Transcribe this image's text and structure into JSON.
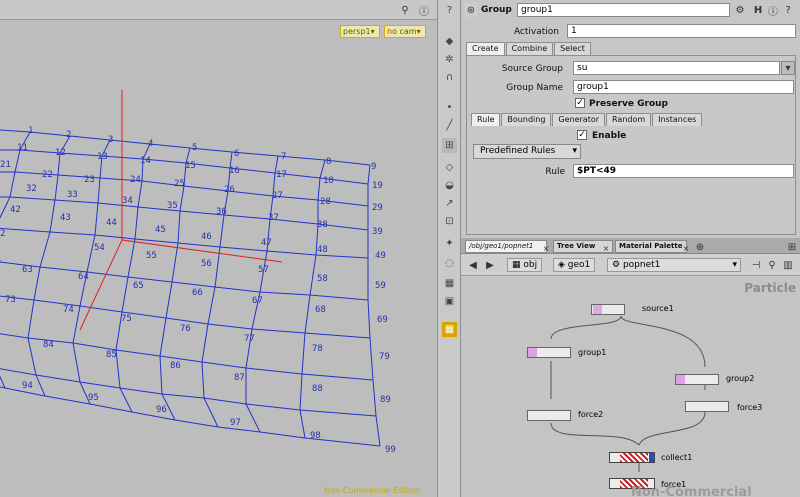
{
  "viewport": {
    "camera": "persp1▾",
    "cam": "no cam▾",
    "nc_text": "Non-Commercial Edition",
    "point_labels": [
      "1",
      "2",
      "3",
      "4",
      "5",
      "6",
      "7",
      "8",
      "9",
      "11",
      "12",
      "13",
      "14",
      "15",
      "16",
      "17",
      "18",
      "19",
      "21",
      "22",
      "23",
      "24",
      "25",
      "26",
      "27",
      "28",
      "29",
      "32",
      "33",
      "34",
      "35",
      "36",
      "37",
      "38",
      "39",
      "42",
      "43",
      "44",
      "45",
      "46",
      "47",
      "48",
      "49",
      "2",
      "54",
      "55",
      "56",
      "57",
      "58",
      "59",
      "63",
      "64",
      "65",
      "66",
      "67",
      "68",
      "69",
      "73",
      "74",
      "75",
      "76",
      "77",
      "78",
      "79",
      "84",
      "85",
      "86",
      "87",
      "88",
      "89",
      "94",
      "95",
      "96",
      "97",
      "98",
      "99"
    ]
  },
  "params": {
    "node_type": "Group",
    "node_name": "group1",
    "activation_label": "Activation",
    "activation_value": "1",
    "tabs": [
      "Create",
      "Combine",
      "Select"
    ],
    "source_group_label": "Source Group",
    "source_group_value": "su",
    "group_name_label": "Group Name",
    "group_name_value": "group1",
    "preserve_group": "Preserve Group",
    "subtabs": [
      "Rule",
      "Bounding",
      "Generator",
      "Random",
      "Instances"
    ],
    "enable": "Enable",
    "predefined": "Predefined Rules",
    "rule_label": "Rule",
    "rule_value": "$PT<49"
  },
  "network": {
    "tabs": [
      "/obj/geo1/popnet1",
      "Tree View",
      "Material Palette"
    ],
    "path": [
      "obj",
      "geo1",
      "popnet1"
    ],
    "particle_label": "Particle",
    "nc_text": "Non-Commercial Edition",
    "nodes": [
      "source1",
      "group1",
      "group2",
      "force2",
      "force3",
      "collect1",
      "force1"
    ]
  },
  "colors": {
    "grid": "#2233cc",
    "axis_red": "#e02020",
    "nc_yellow": "#c9a800"
  }
}
